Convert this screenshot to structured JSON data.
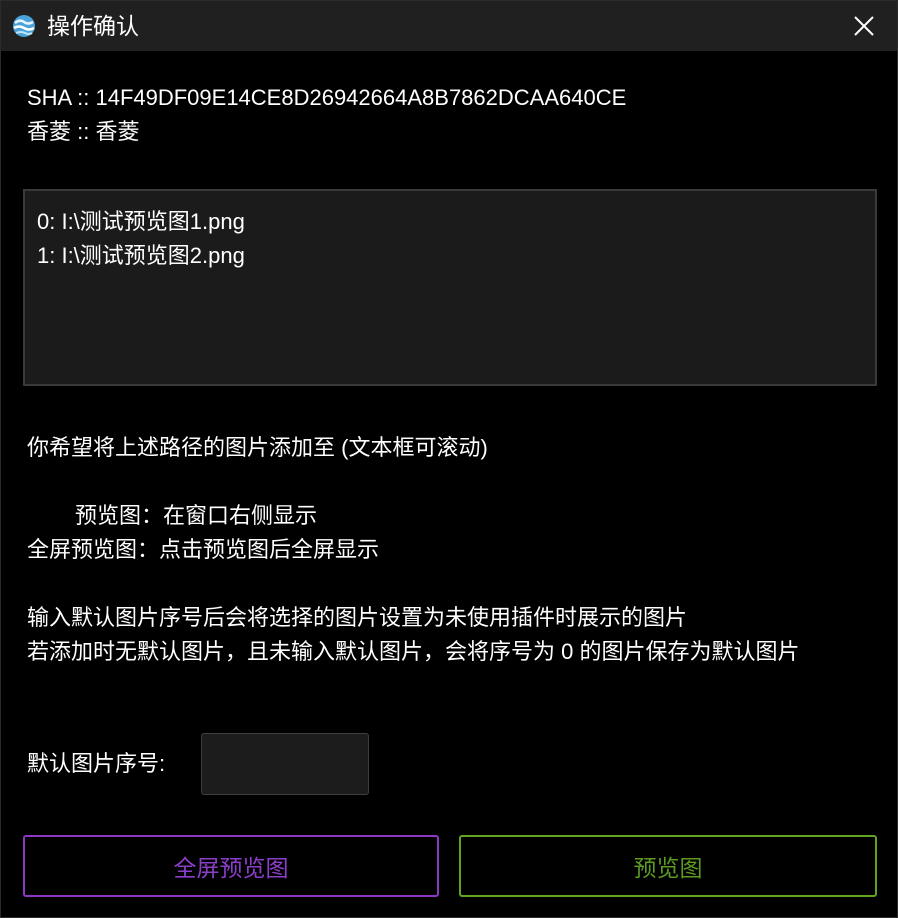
{
  "window": {
    "title": "操作确认",
    "app_icon": "app-globe-icon",
    "close_icon": "close-icon"
  },
  "info": {
    "sha_line": "SHA :: 14F49DF09E14CE8D26942664A8B7862DCAA640CE",
    "name_line": "香菱 :: 香菱"
  },
  "paths": [
    "0: I:\\测试预览图1.png",
    "1: I:\\测试预览图2.png"
  ],
  "prompt": "你希望将上述路径的图片添加至 (文本框可滚动)",
  "options": {
    "preview": "预览图：在窗口右侧显示",
    "fullscreen": "全屏预览图：点击预览图后全屏显示"
  },
  "notes": {
    "line1": "输入默认图片序号后会将选择的图片设置为未使用插件时展示的图片",
    "line2": "若添加时无默认图片，且未输入默认图片，会将序号为 0 的图片保存为默认图片"
  },
  "default_index": {
    "label": "默认图片序号:",
    "value": ""
  },
  "buttons": {
    "fullscreen_preview": "全屏预览图",
    "preview": "预览图"
  },
  "colors": {
    "fullscreen_accent": "#8d37c5",
    "preview_accent": "#61a422",
    "background": "#000000",
    "titlebar": "#202020"
  }
}
